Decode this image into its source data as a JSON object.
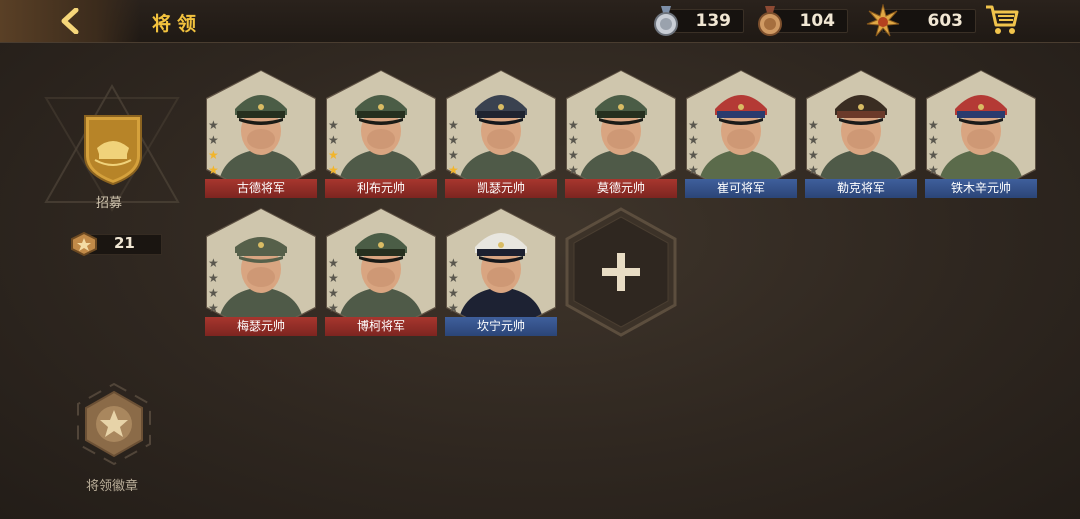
{
  "header": {
    "title": "将领"
  },
  "resources": [
    {
      "name": "silver-medal",
      "value": "139"
    },
    {
      "name": "bronze-medal",
      "value": "104"
    },
    {
      "name": "gold-badge",
      "value": "603"
    }
  ],
  "sidebar": {
    "recruit_label": "招募",
    "recruit_tickets": "21",
    "badge_label": "将领徽章"
  },
  "generals": [
    {
      "name": "古德将军",
      "faction": "red",
      "stars": 2,
      "cap": "green"
    },
    {
      "name": "利布元帅",
      "faction": "red",
      "stars": 2,
      "cap": "green"
    },
    {
      "name": "凯瑟元帅",
      "faction": "red",
      "stars": 1,
      "cap": "navy"
    },
    {
      "name": "莫德元帅",
      "faction": "red",
      "stars": 0,
      "cap": "green"
    },
    {
      "name": "崔可将军",
      "faction": "blue",
      "stars": 0,
      "cap": "sovred"
    },
    {
      "name": "勒克将军",
      "faction": "blue",
      "stars": 0,
      "cap": "kepi"
    },
    {
      "name": "铁木辛元帅",
      "faction": "blue",
      "stars": 0,
      "cap": "sovred"
    },
    {
      "name": "梅瑟元帅",
      "faction": "red",
      "stars": 0,
      "cap": "side"
    },
    {
      "name": "博柯将军",
      "faction": "red",
      "stars": 0,
      "cap": "green"
    },
    {
      "name": "坎宁元帅",
      "faction": "blue",
      "stars": 0,
      "cap": "white"
    }
  ],
  "colors": {
    "title": "#f2c23e",
    "red_plate": "#9a322b",
    "blue_plate": "#36558f",
    "gold_star": "#f2b52c"
  }
}
